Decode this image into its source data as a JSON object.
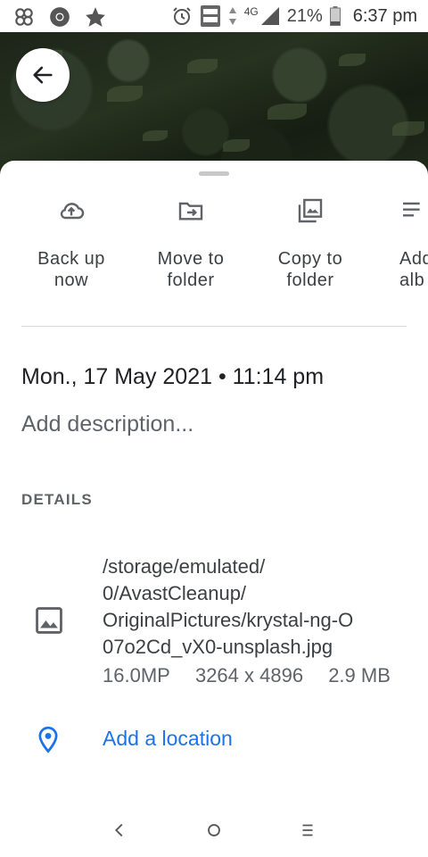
{
  "status_bar": {
    "left_icons": [
      "pinwheel-icon",
      "chrome-icon",
      "avast-icon"
    ],
    "right_icons": [
      "alarm-icon",
      "volte-icon",
      "data-arrows-icon",
      "signal-icon",
      "battery-icon"
    ],
    "network": "4G",
    "battery": "21%",
    "time": "6:37 pm"
  },
  "header": {
    "back_icon": "arrow-left-icon"
  },
  "actions": [
    {
      "icon": "cloud-upload-icon",
      "label": "Back up\nnow"
    },
    {
      "icon": "move-to-folder-icon",
      "label": "Move to\nfolder"
    },
    {
      "icon": "copy-to-folder-icon",
      "label": "Copy to\nfolder"
    },
    {
      "icon": "add-to-album-icon",
      "label": "Add\nalb"
    }
  ],
  "info": {
    "date": "Mon., 17 May 2021 • 11:14 pm",
    "description_placeholder": "Add description..."
  },
  "details": {
    "heading": "DETAILS",
    "file_path_lines": [
      "/storage/emulated/",
      "0/AvastCleanup/",
      "OriginalPictures/krystal-ng-O",
      "07o2Cd_vX0-unsplash.jpg"
    ],
    "megapixels": "16.0MP",
    "resolution": "3264 x 4896",
    "size": "2.9 MB",
    "location_label": "Add a location"
  },
  "nav_bar": {
    "buttons": [
      "back-nav-icon",
      "home-nav-icon",
      "recents-nav-icon"
    ]
  },
  "colors": {
    "accent": "#1a73e8",
    "text": "#3c4043",
    "muted": "#5f6368"
  }
}
